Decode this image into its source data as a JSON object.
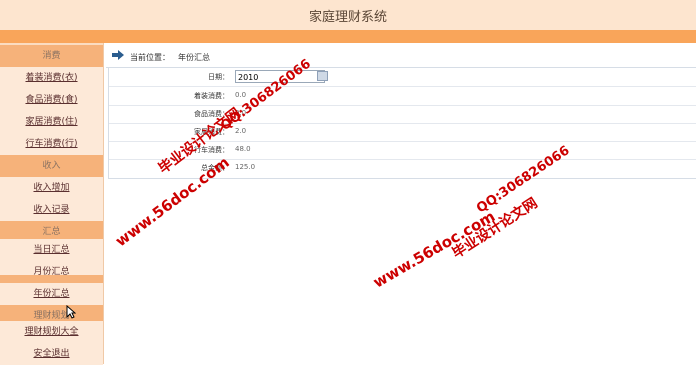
{
  "header": {
    "title": "家庭理财系统"
  },
  "sidebar": {
    "sections": [
      {
        "heading": "消费",
        "items": [
          "着装消费(衣)",
          "食品消费(食)",
          "家居消费(住)",
          "行车消费(行)"
        ]
      },
      {
        "heading": "收入",
        "items": [
          "收入增加",
          "收入记录"
        ]
      },
      {
        "heading": "汇总",
        "items": [
          "当日汇总",
          "月份汇总"
        ]
      },
      {
        "heading": "",
        "items": [
          "年份汇总"
        ]
      },
      {
        "heading": "理财规划",
        "items": [
          "理财规划大全",
          "安全退出"
        ]
      }
    ]
  },
  "breadcrumb": {
    "label": "当前位置：",
    "value": "年份汇总"
  },
  "form": {
    "date_label": "日期：",
    "date_value": "2010",
    "rows": [
      {
        "label": "着装消费：",
        "value": "0.0"
      },
      {
        "label": "食品消费：",
        "value": "0.0"
      },
      {
        "label": "家居消费：",
        "value": "2.0"
      },
      {
        "label": "行车消费：",
        "value": "48.0"
      },
      {
        "label": "总金额：",
        "value": "125.0"
      }
    ]
  },
  "watermarks": {
    "site1": "www.56doc.com",
    "name1": "毕业设计论文网",
    "qq1": "QQ:306826066",
    "site2": "www.56doc.com",
    "qq2": "QQ:306826066",
    "name2": "毕业设计论文网"
  }
}
